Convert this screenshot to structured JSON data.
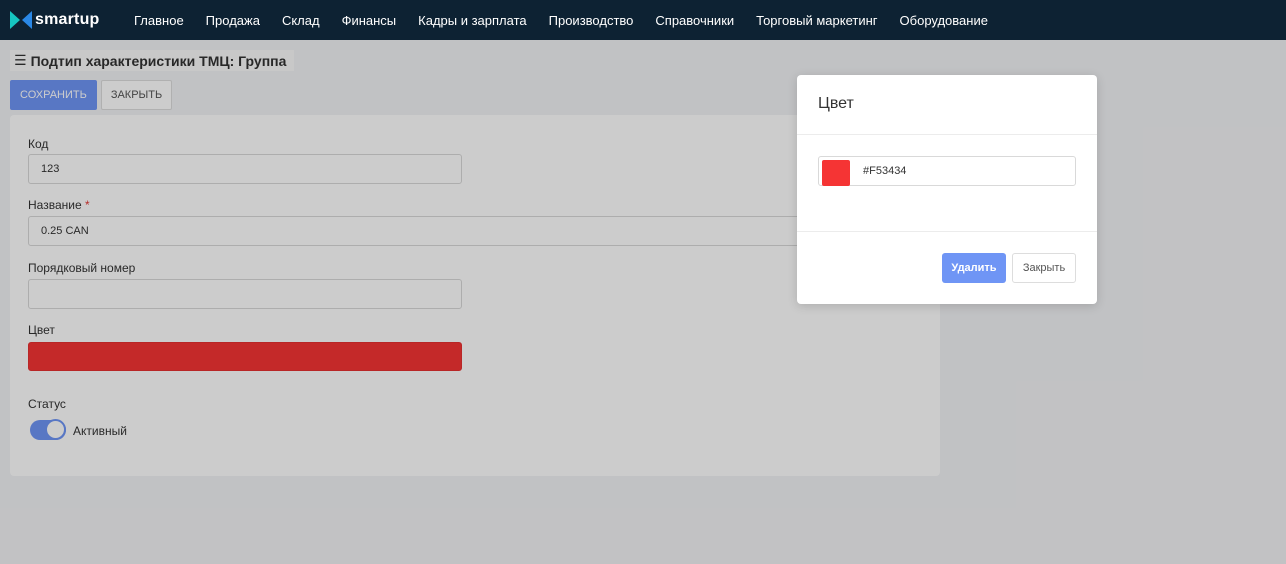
{
  "app": {
    "logo_text": "smartup",
    "nav": [
      "Главное",
      "Продажа",
      "Склад",
      "Финансы",
      "Кадры и зарплата",
      "Производство",
      "Справочники",
      "Торговый маркетинг",
      "Оборудование"
    ]
  },
  "page": {
    "title": "Подтип характеристики ТМЦ: Группа"
  },
  "toolbar": {
    "save_label": "СОХРАНИТЬ",
    "close_label": "ЗАКРЫТЬ"
  },
  "form": {
    "code_label": "Код",
    "code_value": "123",
    "name_label": "Название",
    "required_mark": "*",
    "name_value": "0.25 CAN",
    "order_label": "Порядковый номер",
    "order_value": "",
    "color_label": "Цвет",
    "color_value_hex": "#F53434",
    "status_label": "Статус",
    "status_toggle_label": "Активный",
    "status_active": true
  },
  "modal": {
    "title": "Цвет",
    "color_hex": "#F53434",
    "delete_label": "Удалить",
    "close_label": "Закрыть"
  },
  "colors": {
    "topbar": "#0d2233",
    "accent": "#6f95f5",
    "swatch": "#f53434",
    "logo_left": "#16c6c1",
    "logo_right": "#2a88e6"
  }
}
